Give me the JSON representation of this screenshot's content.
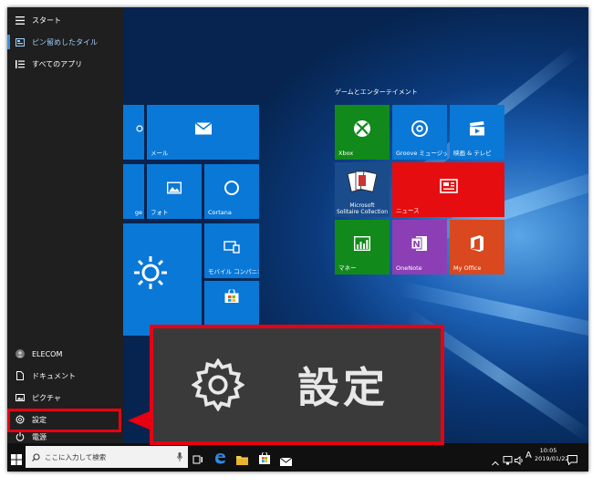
{
  "start_menu": {
    "header_label": "スタート",
    "pinned_label": "ピン留めしたタイル",
    "all_apps_label": "すべてのアプリ",
    "user_label": "ELECOM",
    "documents_label": "ドキュメント",
    "pictures_label": "ピクチャ",
    "settings_label": "設定",
    "power_label": "電源"
  },
  "tiles": {
    "group_title": "ゲームとエンターテイメント",
    "mail_label": "メール",
    "photos_label": "フォト",
    "cortana_label": "Cortana",
    "partial_label": "ge",
    "mobile_label": "モバイル コンパニオン",
    "xbox_label": "Xbox",
    "groove_label": "Groove ミュージック",
    "movies_label": "映画 & テレビ",
    "solitaire_label": "Microsoft\nSolitaire Collection",
    "news_label": "ニュース",
    "money_label": "マネー",
    "onenote_label": "OneNote",
    "office_label": "My Office"
  },
  "callout": {
    "label": "設定",
    "icon": "gear-icon"
  },
  "taskbar": {
    "search_placeholder": "ここに入力して検索",
    "time": "10:05",
    "date": "2019/01/22",
    "ime_label": "A"
  },
  "colors": {
    "highlight": "#e60012",
    "tile_blue": "#0a78d7",
    "tile_green": "#118a1b",
    "tile_red": "#e60d10",
    "tile_purple": "#8c3fb5",
    "tile_orange": "#d9481e"
  }
}
